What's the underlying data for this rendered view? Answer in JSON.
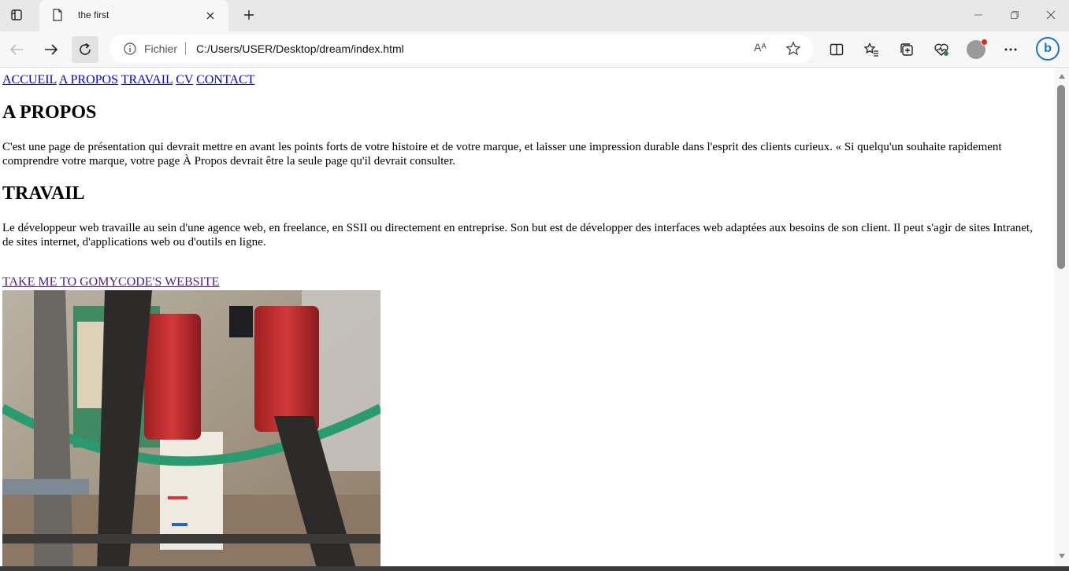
{
  "browser": {
    "tab_title": "the first",
    "omnibox_scheme": "Fichier",
    "url": "C:/Users/USER/Desktop/dream/index.html",
    "read_aloud_label": "Aᴬ",
    "bing_label": "b"
  },
  "page": {
    "nav": [
      "ACCUEIL",
      "A PROPOS",
      "TRAVAIL",
      "CV",
      "CONTACT"
    ],
    "apropos_heading": "A PROPOS",
    "apropos_text": "C'est une page de présentation qui devrait mettre en avant les points forts de votre histoire et de votre marque, et laisser une impression durable dans l'esprit des clients curieux. « Si quelqu'un souhaite rapidement comprendre votre marque, votre page À Propos devrait être la seule page qu'il devrait consulter.",
    "travail_heading": "TRAVAIL",
    "travail_text": "Le développeur web travaille au sein d'une agence web, en freelance, en SSII ou directement en entreprise. Son but est de développer des interfaces web adaptées aux besoins de son client. Il peut s'agir de sites Intranet, de sites internet, d'applications web ou d'outils en ligne.",
    "external_link": "TAKE ME TO GOMYCODE'S WEBSITE"
  },
  "colors": {
    "link": "#0000ee",
    "visited_link": "#551a8b",
    "accent": "#1a73c8",
    "notification_dot": "#e0281d"
  },
  "icons": [
    "tab-actions-icon",
    "page-icon",
    "close-icon",
    "plus-icon",
    "minimize-icon",
    "restore-icon",
    "window-close-icon",
    "back-arrow-icon",
    "forward-arrow-icon",
    "refresh-icon",
    "info-icon",
    "star-icon",
    "split-screen-icon",
    "favorites-icon",
    "collections-icon",
    "browser-essentials-icon",
    "more-icon"
  ]
}
